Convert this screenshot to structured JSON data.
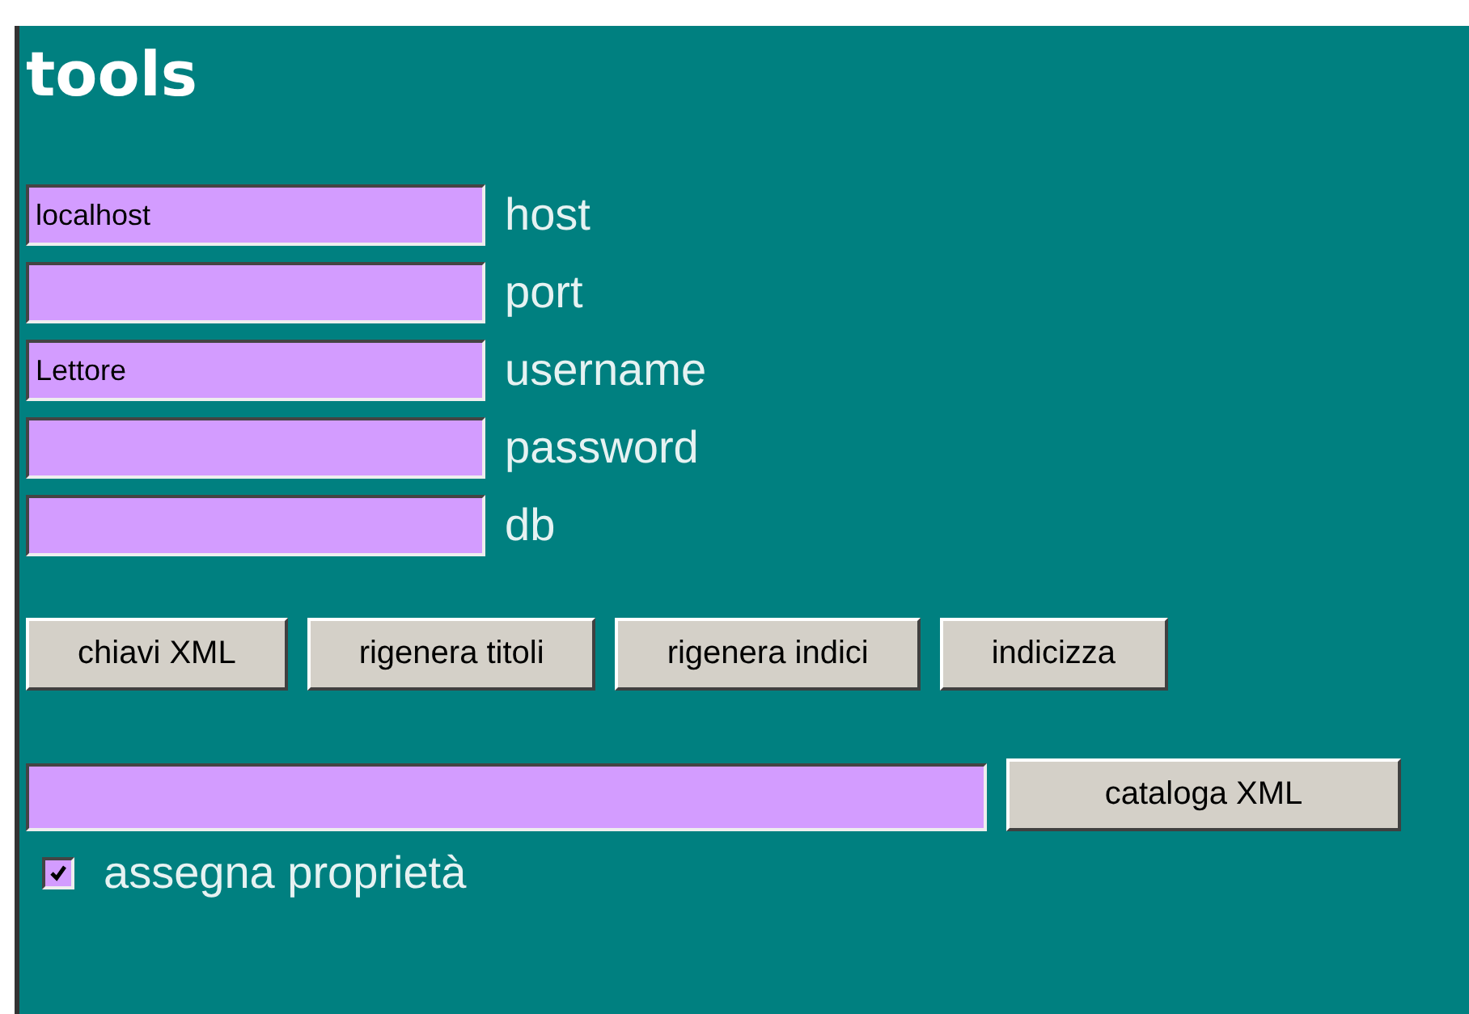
{
  "title": "tools",
  "fields": [
    {
      "value": "localhost",
      "label": "host"
    },
    {
      "label": "port"
    },
    {
      "value": "Lettore",
      "label": "username"
    },
    {
      "label": "password"
    },
    {
      "label": "db"
    }
  ],
  "buttons": [
    "chiavi XML",
    "rigenera titoli",
    "rigenera indici",
    "indicizza"
  ],
  "catalog": {
    "button": "cataloga XML"
  },
  "option": {
    "label": "assegna proprietà",
    "checked": true
  }
}
